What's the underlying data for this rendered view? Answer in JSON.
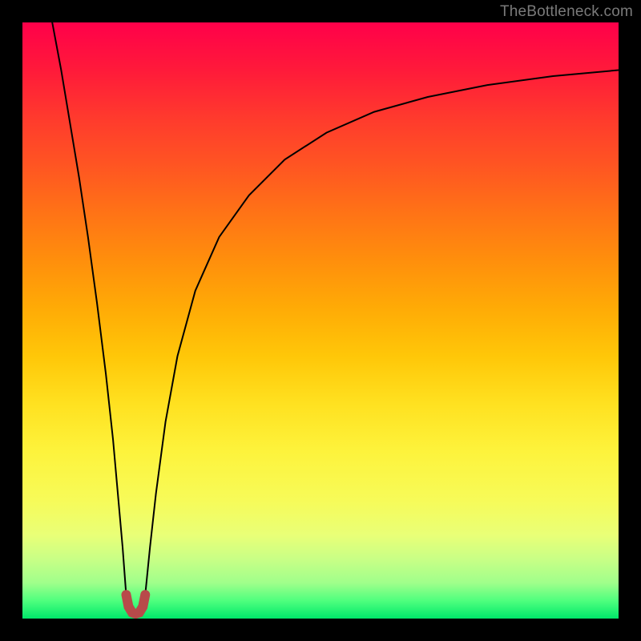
{
  "watermark": {
    "text": "TheBottleneck.com"
  },
  "colors": {
    "frame": "#000000",
    "curve": "#000000",
    "bump": "#b84a4a",
    "gradient_top": "#ff004a",
    "gradient_bottom": "#00e86a",
    "watermark_text": "#7a7a7a"
  },
  "chart_data": {
    "type": "line",
    "title": "",
    "xlabel": "",
    "ylabel": "",
    "xlim": [
      0,
      100
    ],
    "ylim": [
      0,
      100
    ],
    "grid": false,
    "legend": false,
    "note": "No axis labels or tick marks are drawn. Values are read off the plot as percentages of the plot-area width/height (0 = left/bottom, 100 = right/top). Curve appears to be a bottleneck curve with a sharp minimum near x≈18.",
    "series": [
      {
        "name": "left-branch",
        "x": [
          5,
          6.5,
          8,
          9.5,
          11,
          12.5,
          14,
          15.2,
          16,
          16.8,
          17.4
        ],
        "y": [
          100,
          92,
          83,
          74,
          64,
          53,
          41,
          30,
          21,
          12,
          4
        ]
      },
      {
        "name": "right-branch",
        "x": [
          20.6,
          21.4,
          22.4,
          24,
          26,
          29,
          33,
          38,
          44,
          51,
          59,
          68,
          78,
          89,
          100
        ],
        "y": [
          4,
          12,
          21,
          33,
          44,
          55,
          64,
          71,
          77,
          81.5,
          85,
          87.5,
          89.5,
          91,
          92
        ]
      },
      {
        "name": "minimum-bump",
        "comment": "small red U-shaped marker at the curve minimum, drawn thicker",
        "x": [
          17.4,
          17.8,
          18.4,
          19,
          19.6,
          20.2,
          20.6
        ],
        "y": [
          4,
          2,
          1,
          0.8,
          1,
          2,
          4
        ]
      }
    ]
  }
}
